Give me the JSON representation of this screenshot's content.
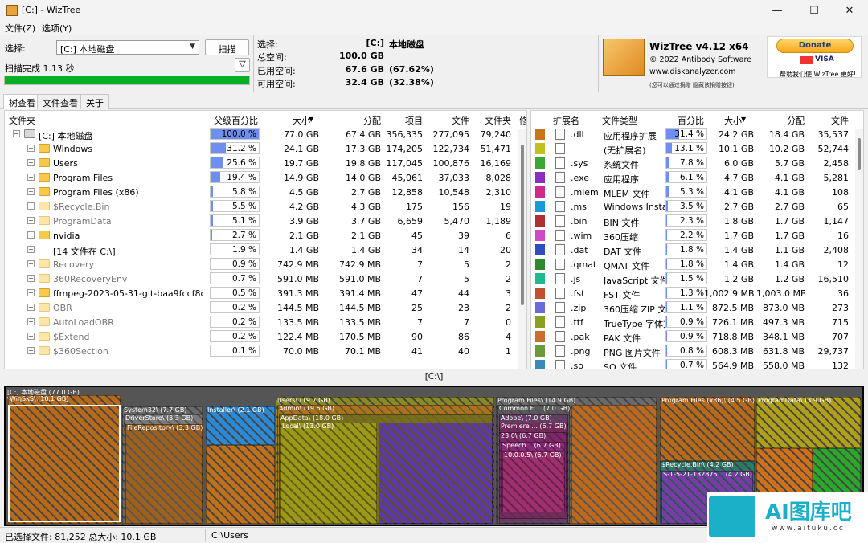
{
  "window": {
    "title": "[C:] - WizTree",
    "controls": [
      "—",
      "☐",
      "✕"
    ]
  },
  "menu": [
    "文件(Z)",
    "选项(Y)"
  ],
  "scan": {
    "select_label": "选择:",
    "drive_value": "[C:] 本地磁盘",
    "scan_button": "扫描",
    "status": "扫描完成 1.13 秒",
    "progress_percent": 100
  },
  "info": {
    "rows": [
      {
        "label": "选择:",
        "v1": "[C:]",
        "v2": "本地磁盘"
      },
      {
        "label": "总空间:",
        "v1": "100.0 GB",
        "v2": ""
      },
      {
        "label": "已用空间:",
        "v1": "67.6 GB",
        "v2": "(67.62%)"
      },
      {
        "label": "可用空间:",
        "v1": "32.4 GB",
        "v2": "(32.38%)"
      }
    ]
  },
  "brand": {
    "name": "WizTree v4.12 x64",
    "copyright": "© 2022 Antibody Software",
    "site": "www.diskanalyzer.com",
    "note": "(您可以通过捐赠 隐藏该捐赠按钮)",
    "donate": "Donate",
    "donate_sub": "帮助我们使 WizTree 更好!",
    "cards": "VISA"
  },
  "tabs": [
    "树查看",
    "文件查看",
    "关于"
  ],
  "tree": {
    "headers": [
      "文件夹",
      "父级百分比",
      "大小",
      "分配",
      "项目",
      "文件",
      "文件夹",
      "修"
    ],
    "rows": [
      {
        "name": "[C:] 本地磁盘",
        "pct": "100.0 %",
        "p": 100,
        "size": "77.0 GB",
        "alloc": "67.4 GB",
        "items": "356,335",
        "files": "277,095",
        "folders": "79,240",
        "level": 0,
        "dim": false,
        "drive": true
      },
      {
        "name": "Windows",
        "pct": "31.2 %",
        "p": 31.2,
        "size": "24.1 GB",
        "alloc": "17.3 GB",
        "items": "174,205",
        "files": "122,734",
        "folders": "51,471",
        "level": 1,
        "dim": false
      },
      {
        "name": "Users",
        "pct": "25.6 %",
        "p": 25.6,
        "size": "19.7 GB",
        "alloc": "19.8 GB",
        "items": "117,045",
        "files": "100,876",
        "folders": "16,169",
        "level": 1,
        "dim": false
      },
      {
        "name": "Program Files",
        "pct": "19.4 %",
        "p": 19.4,
        "size": "14.9 GB",
        "alloc": "14.0 GB",
        "items": "45,061",
        "files": "37,033",
        "folders": "8,028",
        "level": 1,
        "dim": false
      },
      {
        "name": "Program Files (x86)",
        "pct": "5.8 %",
        "p": 5.8,
        "size": "4.5 GB",
        "alloc": "2.7 GB",
        "items": "12,858",
        "files": "10,548",
        "folders": "2,310",
        "level": 1,
        "dim": false
      },
      {
        "name": "$Recycle.Bin",
        "pct": "5.5 %",
        "p": 5.5,
        "size": "4.2 GB",
        "alloc": "4.3 GB",
        "items": "175",
        "files": "156",
        "folders": "19",
        "level": 1,
        "dim": true
      },
      {
        "name": "ProgramData",
        "pct": "5.1 %",
        "p": 5.1,
        "size": "3.9 GB",
        "alloc": "3.7 GB",
        "items": "6,659",
        "files": "5,470",
        "folders": "1,189",
        "level": 1,
        "dim": true
      },
      {
        "name": "nvidia",
        "pct": "2.7 %",
        "p": 2.7,
        "size": "2.1 GB",
        "alloc": "2.1 GB",
        "items": "45",
        "files": "39",
        "folders": "6",
        "level": 1,
        "dim": false
      },
      {
        "name": "[14 文件在 C:\\]",
        "pct": "1.9 %",
        "p": 1.9,
        "size": "1.4 GB",
        "alloc": "1.4 GB",
        "items": "34",
        "files": "14",
        "folders": "20",
        "level": 1,
        "dim": false,
        "nofolder": true
      },
      {
        "name": "Recovery",
        "pct": "0.9 %",
        "p": 0.9,
        "size": "742.9 MB",
        "alloc": "742.9 MB",
        "items": "7",
        "files": "5",
        "folders": "2",
        "level": 1,
        "dim": true
      },
      {
        "name": "360RecoveryEnv",
        "pct": "0.7 %",
        "p": 0.7,
        "size": "591.0 MB",
        "alloc": "591.0 MB",
        "items": "7",
        "files": "5",
        "folders": "2",
        "level": 1,
        "dim": true
      },
      {
        "name": "ffmpeg-2023-05-31-git-baa9fccf8d-full_b",
        "pct": "0.5 %",
        "p": 0.5,
        "size": "391.3 MB",
        "alloc": "391.4 MB",
        "items": "47",
        "files": "44",
        "folders": "3",
        "level": 1,
        "dim": false
      },
      {
        "name": "OBR",
        "pct": "0.2 %",
        "p": 0.2,
        "size": "144.5 MB",
        "alloc": "144.5 MB",
        "items": "25",
        "files": "23",
        "folders": "2",
        "level": 1,
        "dim": true
      },
      {
        "name": "AutoLoadOBR",
        "pct": "0.2 %",
        "p": 0.2,
        "size": "133.5 MB",
        "alloc": "133.5 MB",
        "items": "7",
        "files": "7",
        "folders": "0",
        "level": 1,
        "dim": true
      },
      {
        "name": "$Extend",
        "pct": "0.2 %",
        "p": 0.2,
        "size": "122.4 MB",
        "alloc": "170.5 MB",
        "items": "90",
        "files": "86",
        "folders": "4",
        "level": 1,
        "dim": true
      },
      {
        "name": "$360Section",
        "pct": "0.1 %",
        "p": 0.1,
        "size": "70.0 MB",
        "alloc": "70.1 MB",
        "items": "41",
        "files": "40",
        "folders": "1",
        "level": 1,
        "dim": true
      }
    ]
  },
  "ext": {
    "headers": [
      "扩展名",
      "文件类型",
      "百分比",
      "大小",
      "分配",
      "文件"
    ],
    "rows": [
      {
        "color": "#c8751a",
        "ext": ".dll",
        "type": "应用程序扩展",
        "pct": "31.4 %",
        "p": 31.4,
        "size": "24.2 GB",
        "alloc": "18.4 GB",
        "files": "35,537"
      },
      {
        "color": "#c0c020",
        "ext": "",
        "type": "(无扩展名)",
        "pct": "13.1 %",
        "p": 13.1,
        "size": "10.1 GB",
        "alloc": "10.2 GB",
        "files": "52,744"
      },
      {
        "color": "#3aa832",
        "ext": ".sys",
        "type": "系统文件",
        "pct": "7.8 %",
        "p": 7.8,
        "size": "6.0 GB",
        "alloc": "5.7 GB",
        "files": "2,458"
      },
      {
        "color": "#8a2fc0",
        "ext": ".exe",
        "type": "应用程序",
        "pct": "6.1 %",
        "p": 6.1,
        "size": "4.7 GB",
        "alloc": "4.1 GB",
        "files": "5,281"
      },
      {
        "color": "#d02a8a",
        "ext": ".mlem",
        "type": "MLEM 文件",
        "pct": "5.3 %",
        "p": 5.3,
        "size": "4.1 GB",
        "alloc": "4.1 GB",
        "files": "108"
      },
      {
        "color": "#1a9ad8",
        "ext": ".msi",
        "type": "Windows Installer",
        "pct": "3.5 %",
        "p": 3.5,
        "size": "2.7 GB",
        "alloc": "2.7 GB",
        "files": "65"
      },
      {
        "color": "#b03030",
        "ext": ".bin",
        "type": "BIN 文件",
        "pct": "2.3 %",
        "p": 2.3,
        "size": "1.8 GB",
        "alloc": "1.7 GB",
        "files": "1,147"
      },
      {
        "color": "#d04ac8",
        "ext": ".wim",
        "type": "360压缩",
        "pct": "2.2 %",
        "p": 2.2,
        "size": "1.7 GB",
        "alloc": "1.7 GB",
        "files": "16"
      },
      {
        "color": "#2f4fc0",
        "ext": ".dat",
        "type": "DAT 文件",
        "pct": "1.8 %",
        "p": 1.8,
        "size": "1.4 GB",
        "alloc": "1.1 GB",
        "files": "2,408"
      },
      {
        "color": "#2f8a2f",
        "ext": ".qmat",
        "type": "QMAT 文件",
        "pct": "1.8 %",
        "p": 1.8,
        "size": "1.4 GB",
        "alloc": "1.4 GB",
        "files": "12"
      },
      {
        "color": "#20b890",
        "ext": ".js",
        "type": "JavaScript 文件",
        "pct": "1.5 %",
        "p": 1.5,
        "size": "1.2 GB",
        "alloc": "1.2 GB",
        "files": "16,510"
      },
      {
        "color": "#c05030",
        "ext": ".fst",
        "type": "FST 文件",
        "pct": "1.3 %",
        "p": 1.3,
        "size": "1,002.9 MB",
        "alloc": "1,003.0 MB",
        "files": "36"
      },
      {
        "color": "#6a6ad8",
        "ext": ".zip",
        "type": "360压缩 ZIP 文件",
        "pct": "1.1 %",
        "p": 1.1,
        "size": "872.5 MB",
        "alloc": "873.0 MB",
        "files": "273"
      },
      {
        "color": "#8aa020",
        "ext": ".ttf",
        "type": "TrueType 字体文件",
        "pct": "0.9 %",
        "p": 0.9,
        "size": "726.1 MB",
        "alloc": "497.3 MB",
        "files": "715"
      },
      {
        "color": "#c87030",
        "ext": ".pak",
        "type": "PAK 文件",
        "pct": "0.9 %",
        "p": 0.9,
        "size": "718.8 MB",
        "alloc": "348.1 MB",
        "files": "707"
      },
      {
        "color": "#6a9a3a",
        "ext": ".png",
        "type": "PNG 图片文件",
        "pct": "0.8 %",
        "p": 0.8,
        "size": "608.3 MB",
        "alloc": "631.8 MB",
        "files": "29,737"
      },
      {
        "color": "#3a8ab8",
        "ext": ".so",
        "type": "SO 文件",
        "pct": "0.7 %",
        "p": 0.7,
        "size": "564.9 MB",
        "alloc": "558.0 MB",
        "files": "132"
      }
    ]
  },
  "path": "[C:\\]",
  "treemap": {
    "root": "[C:] 本地磁盘 (77.0 GB)",
    "labels": [
      "Windows\\ (24.1 GB)",
      "WinSxS\\ (10.1 GB)",
      "System32\\ (7.7 GB)",
      "DriverStore\\ (3.3 GB)",
      "FileRepository\\ (3.3 GB)",
      "Installer\\ (2.1 GB)",
      "Users\\ (19.7 GB)",
      "Admin\\ (19.5 GB)",
      "AppData\\ (18.0 GB)",
      "Local\\ (13.0 GB)",
      "Program Files\\ (14.9 GB)",
      "Common Fi... (7.0 GB)",
      "Adobe\\ (7.0 GB)",
      "Premiere ... (6.7 GB)",
      "23.0\\ (6.7 GB)",
      "Speech... (6.7 GB)",
      "10.0.0.5\\ (6.7 GB)",
      "Program Files (x86)\\ (4.5 GB)",
      "$Recycle.Bin\\ (4.2 GB)",
      "S-1-5-21-132875... (4.2 GB)",
      "ProgramData\\ (3.9 GB)"
    ]
  },
  "status": {
    "selected": "已选择文件: 81,252  总大小: 10.1 GB",
    "path": "C:\\Users"
  },
  "watermark": {
    "text": "AI图库吧",
    "url": "www.aituku.cc"
  }
}
